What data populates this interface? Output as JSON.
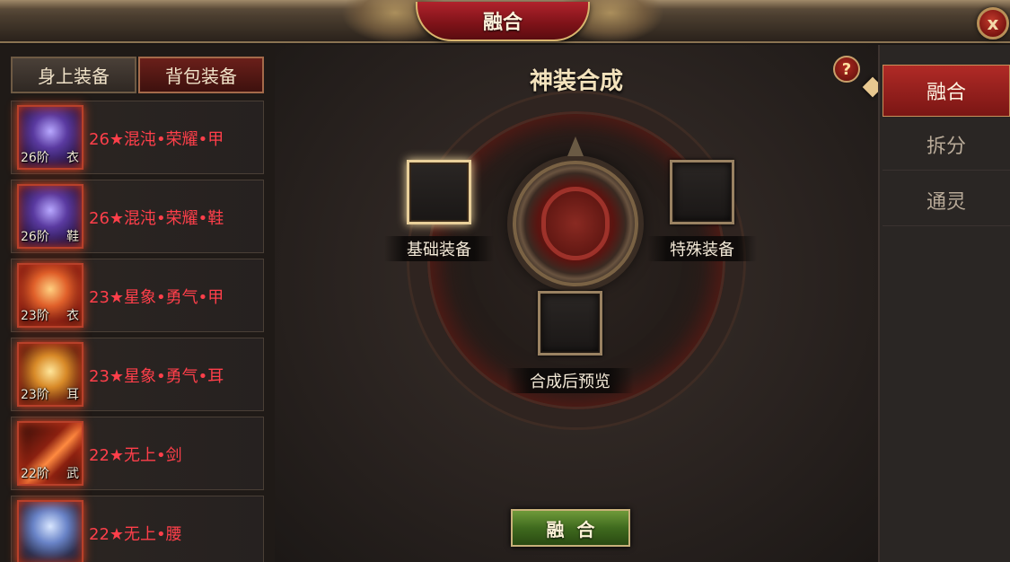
{
  "window": {
    "title": "融合",
    "close_label": "x"
  },
  "left": {
    "tabs": [
      {
        "label": "身上装备",
        "active": false
      },
      {
        "label": "背包装备",
        "active": true
      }
    ],
    "items": [
      {
        "tier": "26阶",
        "slot": "衣",
        "name": "26★混沌•荣耀•甲",
        "icon": "purple-armor-icon"
      },
      {
        "tier": "26阶",
        "slot": "鞋",
        "name": "26★混沌•荣耀•鞋",
        "icon": "purple-boots-icon"
      },
      {
        "tier": "23阶",
        "slot": "衣",
        "name": "23★星象•勇气•甲",
        "icon": "fire-armor-icon"
      },
      {
        "tier": "23阶",
        "slot": "耳",
        "name": "23★星象•勇气•耳",
        "icon": "gold-earring-icon"
      },
      {
        "tier": "22阶",
        "slot": "武",
        "name": "22★无上•剑",
        "icon": "fire-sword-icon"
      },
      {
        "tier": "",
        "slot": "",
        "name": "22★无上•腰",
        "icon": "blue-belt-icon"
      }
    ]
  },
  "center": {
    "title": "神装合成",
    "help_label": "?",
    "slots": {
      "base": "基础装备",
      "special": "特殊装备",
      "preview": "合成后预览"
    },
    "fuse_button": "融合"
  },
  "right": {
    "tabs": [
      {
        "label": "融合",
        "active": true
      },
      {
        "label": "拆分",
        "active": false
      },
      {
        "label": "通灵",
        "active": false
      }
    ]
  },
  "colors": {
    "item_name": "#ff3f4a",
    "accent_red": "#b02a26",
    "fuse_green": "#4f7a28",
    "gold_border": "#c9b17a"
  }
}
